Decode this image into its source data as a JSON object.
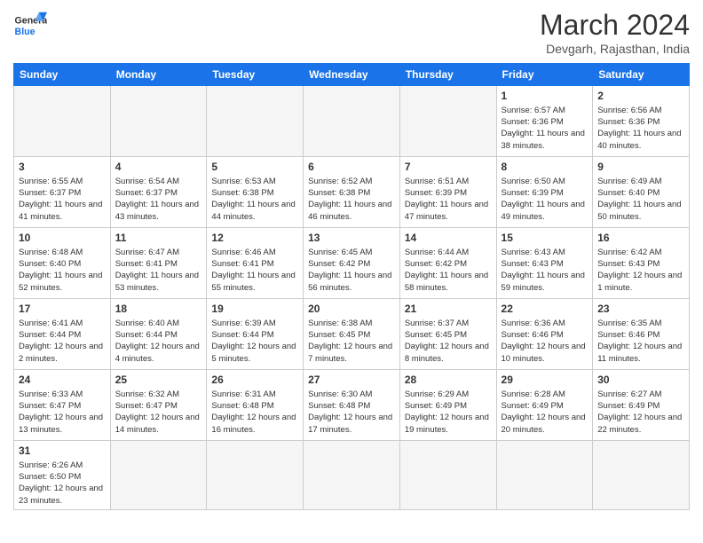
{
  "header": {
    "logo_general": "General",
    "logo_blue": "Blue",
    "month": "March 2024",
    "location": "Devgarh, Rajasthan, India"
  },
  "weekdays": [
    "Sunday",
    "Monday",
    "Tuesday",
    "Wednesday",
    "Thursday",
    "Friday",
    "Saturday"
  ],
  "weeks": [
    [
      {
        "day": "",
        "empty": true
      },
      {
        "day": "",
        "empty": true
      },
      {
        "day": "",
        "empty": true
      },
      {
        "day": "",
        "empty": true
      },
      {
        "day": "",
        "empty": true
      },
      {
        "day": "1",
        "sunrise": "6:57 AM",
        "sunset": "6:36 PM",
        "daylight": "11 hours and 38 minutes."
      },
      {
        "day": "2",
        "sunrise": "6:56 AM",
        "sunset": "6:36 PM",
        "daylight": "11 hours and 40 minutes."
      }
    ],
    [
      {
        "day": "3",
        "sunrise": "6:55 AM",
        "sunset": "6:37 PM",
        "daylight": "11 hours and 41 minutes."
      },
      {
        "day": "4",
        "sunrise": "6:54 AM",
        "sunset": "6:37 PM",
        "daylight": "11 hours and 43 minutes."
      },
      {
        "day": "5",
        "sunrise": "6:53 AM",
        "sunset": "6:38 PM",
        "daylight": "11 hours and 44 minutes."
      },
      {
        "day": "6",
        "sunrise": "6:52 AM",
        "sunset": "6:38 PM",
        "daylight": "11 hours and 46 minutes."
      },
      {
        "day": "7",
        "sunrise": "6:51 AM",
        "sunset": "6:39 PM",
        "daylight": "11 hours and 47 minutes."
      },
      {
        "day": "8",
        "sunrise": "6:50 AM",
        "sunset": "6:39 PM",
        "daylight": "11 hours and 49 minutes."
      },
      {
        "day": "9",
        "sunrise": "6:49 AM",
        "sunset": "6:40 PM",
        "daylight": "11 hours and 50 minutes."
      }
    ],
    [
      {
        "day": "10",
        "sunrise": "6:48 AM",
        "sunset": "6:40 PM",
        "daylight": "11 hours and 52 minutes."
      },
      {
        "day": "11",
        "sunrise": "6:47 AM",
        "sunset": "6:41 PM",
        "daylight": "11 hours and 53 minutes."
      },
      {
        "day": "12",
        "sunrise": "6:46 AM",
        "sunset": "6:41 PM",
        "daylight": "11 hours and 55 minutes."
      },
      {
        "day": "13",
        "sunrise": "6:45 AM",
        "sunset": "6:42 PM",
        "daylight": "11 hours and 56 minutes."
      },
      {
        "day": "14",
        "sunrise": "6:44 AM",
        "sunset": "6:42 PM",
        "daylight": "11 hours and 58 minutes."
      },
      {
        "day": "15",
        "sunrise": "6:43 AM",
        "sunset": "6:43 PM",
        "daylight": "11 hours and 59 minutes."
      },
      {
        "day": "16",
        "sunrise": "6:42 AM",
        "sunset": "6:43 PM",
        "daylight": "12 hours and 1 minute."
      }
    ],
    [
      {
        "day": "17",
        "sunrise": "6:41 AM",
        "sunset": "6:44 PM",
        "daylight": "12 hours and 2 minutes."
      },
      {
        "day": "18",
        "sunrise": "6:40 AM",
        "sunset": "6:44 PM",
        "daylight": "12 hours and 4 minutes."
      },
      {
        "day": "19",
        "sunrise": "6:39 AM",
        "sunset": "6:44 PM",
        "daylight": "12 hours and 5 minutes."
      },
      {
        "day": "20",
        "sunrise": "6:38 AM",
        "sunset": "6:45 PM",
        "daylight": "12 hours and 7 minutes."
      },
      {
        "day": "21",
        "sunrise": "6:37 AM",
        "sunset": "6:45 PM",
        "daylight": "12 hours and 8 minutes."
      },
      {
        "day": "22",
        "sunrise": "6:36 AM",
        "sunset": "6:46 PM",
        "daylight": "12 hours and 10 minutes."
      },
      {
        "day": "23",
        "sunrise": "6:35 AM",
        "sunset": "6:46 PM",
        "daylight": "12 hours and 11 minutes."
      }
    ],
    [
      {
        "day": "24",
        "sunrise": "6:33 AM",
        "sunset": "6:47 PM",
        "daylight": "12 hours and 13 minutes."
      },
      {
        "day": "25",
        "sunrise": "6:32 AM",
        "sunset": "6:47 PM",
        "daylight": "12 hours and 14 minutes."
      },
      {
        "day": "26",
        "sunrise": "6:31 AM",
        "sunset": "6:48 PM",
        "daylight": "12 hours and 16 minutes."
      },
      {
        "day": "27",
        "sunrise": "6:30 AM",
        "sunset": "6:48 PM",
        "daylight": "12 hours and 17 minutes."
      },
      {
        "day": "28",
        "sunrise": "6:29 AM",
        "sunset": "6:49 PM",
        "daylight": "12 hours and 19 minutes."
      },
      {
        "day": "29",
        "sunrise": "6:28 AM",
        "sunset": "6:49 PM",
        "daylight": "12 hours and 20 minutes."
      },
      {
        "day": "30",
        "sunrise": "6:27 AM",
        "sunset": "6:49 PM",
        "daylight": "12 hours and 22 minutes."
      }
    ],
    [
      {
        "day": "31",
        "sunrise": "6:26 AM",
        "sunset": "6:50 PM",
        "daylight": "12 hours and 23 minutes."
      },
      {
        "day": "",
        "empty": true
      },
      {
        "day": "",
        "empty": true
      },
      {
        "day": "",
        "empty": true
      },
      {
        "day": "",
        "empty": true
      },
      {
        "day": "",
        "empty": true
      },
      {
        "day": "",
        "empty": true
      }
    ]
  ]
}
